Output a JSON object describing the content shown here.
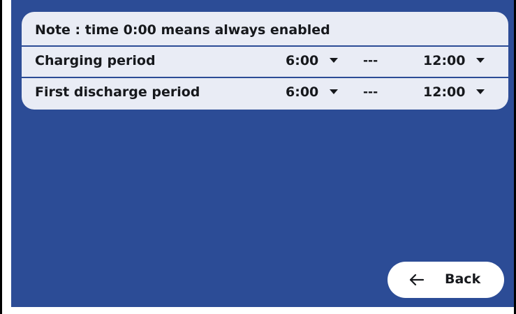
{
  "note": {
    "text": "Note : time 0:00 means always enabled"
  },
  "periods": [
    {
      "label": "Charging period",
      "start": "6:00",
      "separator": "---",
      "end": "12:00"
    },
    {
      "label": "First discharge period",
      "start": "6:00",
      "separator": "---",
      "end": "12:00"
    }
  ],
  "back_button": {
    "icon": "arrow-left-icon",
    "label": "Back"
  },
  "colors": {
    "background": "#2c4c96",
    "panel": "#e9ecf5",
    "text": "#16181c",
    "button": "#ffffff"
  }
}
